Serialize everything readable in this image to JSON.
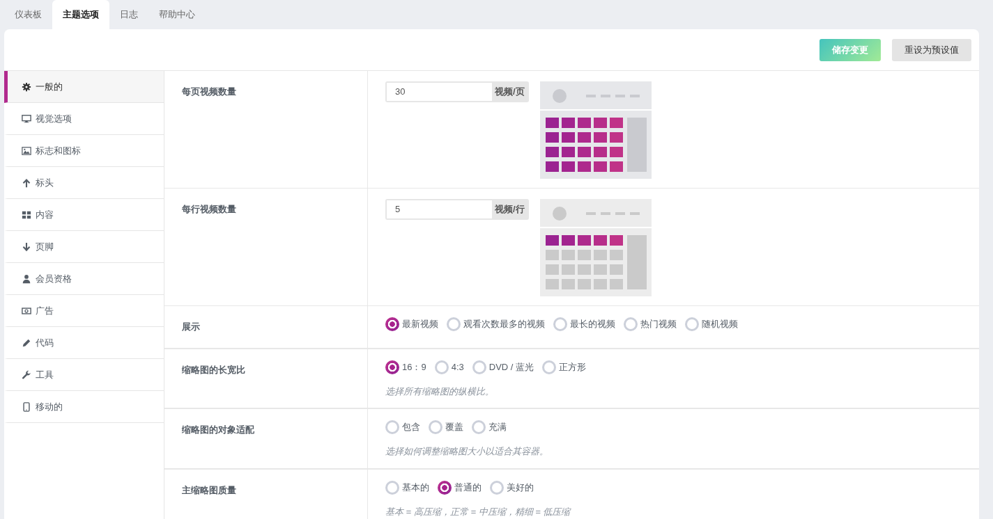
{
  "tabs": [
    {
      "label": "仪表板",
      "selected": false
    },
    {
      "label": "主题选项",
      "selected": true
    },
    {
      "label": "日志",
      "selected": false
    },
    {
      "label": "帮助中心",
      "selected": false
    }
  ],
  "buttons": [
    {
      "label": "储存变更",
      "kind": "primary"
    },
    {
      "label": "重设为预设值",
      "kind": "secondary"
    }
  ],
  "sidebar": {
    "items": [
      {
        "label": "一般的",
        "selected": true
      },
      {
        "label": "视觉选项",
        "selected": false
      },
      {
        "label": "标志和图标",
        "selected": false
      },
      {
        "label": "标头",
        "selected": false
      },
      {
        "label": "内容",
        "selected": false
      },
      {
        "label": "页脚",
        "selected": false
      },
      {
        "label": "会员资格",
        "selected": false
      },
      {
        "label": "广告",
        "selected": false
      },
      {
        "label": "代码",
        "selected": false
      },
      {
        "label": "工具",
        "selected": false
      },
      {
        "label": "移动的",
        "selected": false
      }
    ]
  },
  "settings": [
    {
      "kind": "number",
      "label": "每页视频数量",
      "value": "30",
      "unit": "视频/页",
      "preview": {
        "kind": "page"
      }
    },
    {
      "kind": "number",
      "label": "每行视频数量",
      "value": "5",
      "unit": "视频/行",
      "preview": {
        "kind": "row"
      }
    },
    {
      "kind": "radio",
      "label": "展示",
      "options": [
        {
          "label": "最新视频",
          "selected": true
        },
        {
          "label": "观看次数最多的视频",
          "selected": false
        },
        {
          "label": "最长的视频",
          "selected": false
        },
        {
          "label": "热门视频",
          "selected": false
        },
        {
          "label": "随机视频",
          "selected": false
        }
      ]
    },
    {
      "kind": "radio",
      "label": "缩略图的长宽比",
      "options": [
        {
          "label": "16：9",
          "selected": true
        },
        {
          "label": "4:3",
          "selected": false
        },
        {
          "label": "DVD / 蓝光",
          "selected": false
        },
        {
          "label": "正方形",
          "selected": false
        }
      ],
      "hint": "选择所有缩略图的纵横比。"
    },
    {
      "kind": "radio",
      "label": "缩略图的对象适配",
      "options": [
        {
          "label": "包含",
          "selected": false
        },
        {
          "label": "覆盖",
          "selected": false
        },
        {
          "label": "充满",
          "selected": false
        }
      ],
      "hint": "选择如何调整缩略图大小以适合其容器。"
    },
    {
      "kind": "radio",
      "label": "主缩略图质量",
      "options": [
        {
          "label": "基本的",
          "selected": false
        },
        {
          "label": "普通的",
          "selected": true
        },
        {
          "label": "美好的",
          "selected": false
        }
      ],
      "hint": "基本 = 高压缩，正常 = 中压缩，精细 = 低压缩"
    }
  ]
}
